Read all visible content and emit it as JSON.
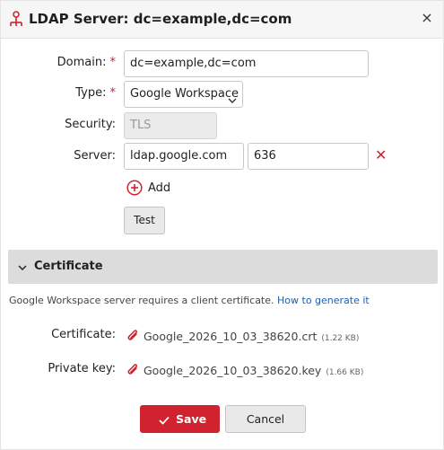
{
  "dialog": {
    "title": "LDAP Server: dc=example,dc=com",
    "icon": "ldap-server-icon",
    "close": "×"
  },
  "form": {
    "domain": {
      "label": "Domain:",
      "required": "*",
      "value": "dc=example,dc=com"
    },
    "type": {
      "label": "Type:",
      "required": "*",
      "value": "Google Workspace"
    },
    "security": {
      "label": "Security:",
      "value": "TLS"
    },
    "server": {
      "label": "Server:",
      "host": "ldap.google.com",
      "port": "636",
      "remove": "✕"
    },
    "add_label": "Add",
    "test_label": "Test"
  },
  "certificate_section": {
    "title": "Certificate",
    "info_text": "Google Workspace server requires a client certificate.",
    "info_link": "How to generate it",
    "certificate": {
      "label": "Certificate:",
      "file": "Google_2026_10_03_38620.crt",
      "size": "(1.22 KB)"
    },
    "private_key": {
      "label": "Private key:",
      "file": "Google_2026_10_03_38620.key",
      "size": "(1.66 KB)"
    }
  },
  "footer": {
    "save_label": "Save",
    "cancel_label": "Cancel"
  },
  "colors": {
    "accent": "#d0222f",
    "link": "#1a5fb4",
    "section_bg": "#dcdcdc",
    "titlebar_bg": "#f6f6f6"
  }
}
